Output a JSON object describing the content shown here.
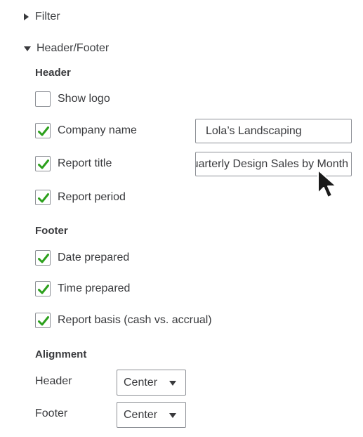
{
  "filter": {
    "label": "Filter"
  },
  "header_footer": {
    "label": "Header/Footer",
    "header": {
      "label": "Header",
      "options": [
        {
          "label": "Show logo",
          "checked": false
        },
        {
          "label": "Company name",
          "checked": true,
          "value": "Lola’s Landscaping"
        },
        {
          "label": "Report title",
          "checked": true,
          "value": "Quarterly Design Sales by Month"
        },
        {
          "label": "Report period",
          "checked": true
        }
      ]
    },
    "footer": {
      "label": "Footer",
      "options": [
        {
          "label": "Date prepared",
          "checked": true
        },
        {
          "label": "Time prepared",
          "checked": true
        },
        {
          "label": "Report basis (cash vs. accrual)",
          "checked": true
        }
      ]
    },
    "alignment": {
      "label": "Alignment",
      "header_label": "Header",
      "header_value": "Center",
      "footer_label": "Footer",
      "footer_value": "Center"
    }
  },
  "colors": {
    "check": "#2ca01c",
    "text": "#393a3d",
    "border": "#8d9096"
  },
  "icons": [
    "caret-right-icon",
    "caret-down-icon",
    "checkmark-icon",
    "dropdown-arrow-icon",
    "mouse-pointer-icon"
  ]
}
